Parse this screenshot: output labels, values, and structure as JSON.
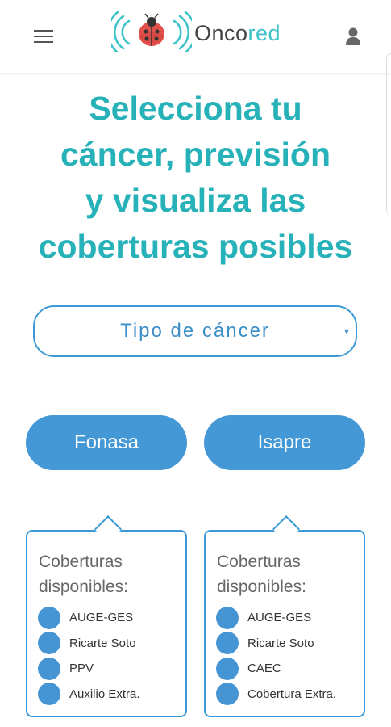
{
  "header": {
    "menu_icon": "hamburger-menu-icon",
    "logo": {
      "text_prefix": "Onco",
      "text_accent": "red",
      "icon": "ladybug-signal-icon"
    },
    "user_icon": "user-icon"
  },
  "title": {
    "lines": [
      "Selecciona tu",
      "cáncer, previsión",
      "y visualiza las",
      "coberturas posibles"
    ]
  },
  "cancer_select": {
    "value": "Tipo de cáncer",
    "caret": "▾"
  },
  "buttons": {
    "fonasa": "Fonasa",
    "isapre": "Isapre"
  },
  "cards": [
    {
      "title_lines": [
        "Coberturas",
        "disponibles:"
      ],
      "items": [
        "AUGE-GES",
        "Ricarte Soto",
        "PPV",
        "Auxilio Extra."
      ]
    },
    {
      "title_lines": [
        "Coberturas",
        "disponibles:"
      ],
      "items": [
        "AUGE-GES",
        "Ricarte Soto",
        "CAEC",
        "Cobertura Extra."
      ]
    }
  ],
  "colors": {
    "teal": "#27b1b8",
    "blue": "#4598d6"
  }
}
